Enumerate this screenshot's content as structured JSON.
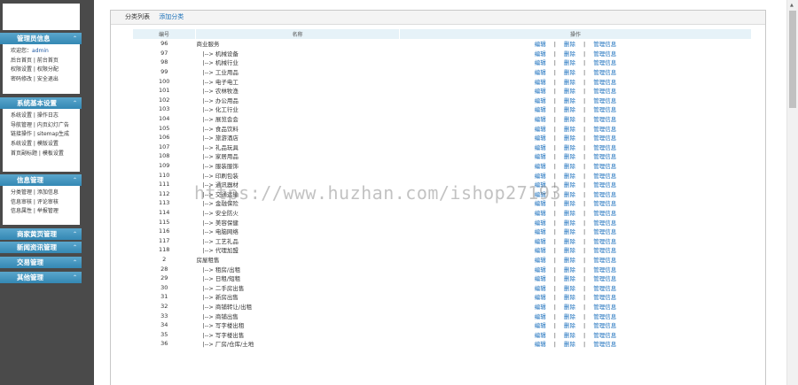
{
  "sidebar": {
    "sections": [
      {
        "title": "管理员信息",
        "lines": [
          [
            {
              "t": "欢迎您：",
              "u": false
            },
            {
              "t": "admin",
              "u": true
            }
          ],
          [
            {
              "t": "后台首页 | 前台首页",
              "u": false
            }
          ],
          [
            {
              "t": "权限设置 | 权限分配",
              "u": false
            }
          ],
          [
            {
              "t": "密码修改 | 安全退出",
              "u": false
            }
          ]
        ]
      },
      {
        "title": "系统基本设置",
        "lines": [
          [
            {
              "t": "系统设置 | 操作日志",
              "u": false
            }
          ],
          [
            {
              "t": "导航管理 | 内页幻灯广告",
              "u": false
            }
          ],
          [
            {
              "t": "链接操作 | sitemap生成",
              "u": false
            }
          ],
          [
            {
              "t": "系统设置 | 模版设置",
              "u": false
            }
          ],
          [
            {
              "t": "首页副标题 | 模板设置",
              "u": false
            }
          ]
        ]
      },
      {
        "title": "信息管理",
        "lines": [
          [
            {
              "t": "分类管理 | 添加信息",
              "u": false
            }
          ],
          [
            {
              "t": "信息审核 | 评论审核",
              "u": false
            }
          ],
          [
            {
              "t": "信息属性 | 举报管理",
              "u": false
            }
          ]
        ]
      },
      {
        "title": "商家黄页管理",
        "lines": []
      },
      {
        "title": "新闻资讯管理",
        "lines": []
      },
      {
        "title": "交易管理",
        "lines": []
      },
      {
        "title": "其他管理",
        "lines": []
      }
    ]
  },
  "toolbar": {
    "list_label": "分类列表",
    "add_label": "添加分类"
  },
  "table": {
    "headers": [
      "编号",
      "名称",
      "操作"
    ],
    "ops": {
      "edit": "编辑",
      "delete": "删除",
      "manage": "管理信息",
      "sep": "|"
    },
    "rows": [
      {
        "id": "96",
        "name": "商业服务",
        "child": false
      },
      {
        "id": "97",
        "name": "|--> 机械设备",
        "child": true
      },
      {
        "id": "98",
        "name": "|--> 机械行业",
        "child": true
      },
      {
        "id": "99",
        "name": "|--> 工业用品",
        "child": true
      },
      {
        "id": "100",
        "name": "|--> 电子电工",
        "child": true
      },
      {
        "id": "101",
        "name": "|--> 农林牧渔",
        "child": true
      },
      {
        "id": "102",
        "name": "|--> 办公用品",
        "child": true
      },
      {
        "id": "103",
        "name": "|--> 化工行业",
        "child": true
      },
      {
        "id": "104",
        "name": "|--> 展览会会",
        "child": true
      },
      {
        "id": "105",
        "name": "|--> 食品饮料",
        "child": true
      },
      {
        "id": "106",
        "name": "|--> 旅游酒店",
        "child": true
      },
      {
        "id": "107",
        "name": "|--> 礼品玩具",
        "child": true
      },
      {
        "id": "108",
        "name": "|--> 家居用品",
        "child": true
      },
      {
        "id": "109",
        "name": "|--> 服装服饰",
        "child": true
      },
      {
        "id": "110",
        "name": "|--> 印刷包装",
        "child": true
      },
      {
        "id": "111",
        "name": "|--> 通讯器材",
        "child": true
      },
      {
        "id": "112",
        "name": "|--> 交通运输",
        "child": true
      },
      {
        "id": "113",
        "name": "|--> 金融保险",
        "child": true
      },
      {
        "id": "114",
        "name": "|--> 安全防火",
        "child": true
      },
      {
        "id": "115",
        "name": "|--> 美容保健",
        "child": true
      },
      {
        "id": "116",
        "name": "|--> 电脑网络",
        "child": true
      },
      {
        "id": "117",
        "name": "|--> 工艺礼品",
        "child": true
      },
      {
        "id": "118",
        "name": "|--> 代理加盟",
        "child": true
      },
      {
        "id": "2",
        "name": "房屋租售",
        "child": false
      },
      {
        "id": "28",
        "name": "|--> 租房/出租",
        "child": true
      },
      {
        "id": "29",
        "name": "|--> 日租/短租",
        "child": true
      },
      {
        "id": "30",
        "name": "|--> 二手房出售",
        "child": true
      },
      {
        "id": "31",
        "name": "|--> 新房出售",
        "child": true
      },
      {
        "id": "32",
        "name": "|--> 商铺转让/出租",
        "child": true
      },
      {
        "id": "33",
        "name": "|--> 商铺出售",
        "child": true
      },
      {
        "id": "34",
        "name": "|--> 写字楼出租",
        "child": true
      },
      {
        "id": "35",
        "name": "|--> 写字楼出售",
        "child": true
      },
      {
        "id": "36",
        "name": "|--> 厂房/仓库/土地",
        "child": true
      }
    ]
  },
  "watermark": "https://www.huzhan.com/ishop27193"
}
